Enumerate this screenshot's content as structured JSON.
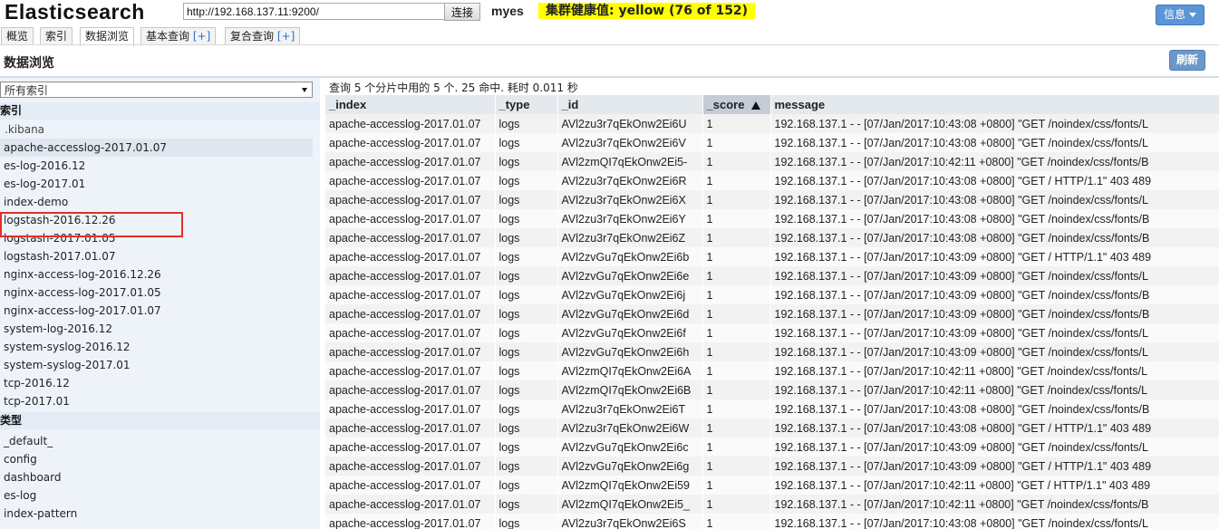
{
  "header": {
    "app_title": "Elasticsearch",
    "cluster_url": "http://192.168.137.11:9200/",
    "connect_label": "连接",
    "cluster_name": "myes",
    "health_text": "集群健康值: yellow (76 of 152)",
    "health_color": "#ffff00",
    "info_label": "信息"
  },
  "tabs": [
    {
      "label": "概览",
      "plus": ""
    },
    {
      "label": "索引",
      "plus": ""
    },
    {
      "label": "数据浏览",
      "plus": ""
    },
    {
      "label": "基本查询 ",
      "plus": "[+]"
    },
    {
      "label": "复合查询 ",
      "plus": "[+]"
    }
  ],
  "page": {
    "title": "数据浏览",
    "refresh_label": "刷新"
  },
  "sidebar": {
    "select_value": "所有索引",
    "indices_heading": "索引",
    "indices": [
      ".kibana",
      "apache-accesslog-2017.01.07",
      "es-log-2016.12",
      "es-log-2017.01",
      "index-demo",
      "logstash-2016.12.26",
      "logstash-2017.01.05",
      "logstash-2017.01.07",
      "nginx-access-log-2016.12.26",
      "nginx-access-log-2017.01.05",
      "nginx-access-log-2017.01.07",
      "system-log-2016.12",
      "system-syslog-2016.12",
      "system-syslog-2017.01",
      "tcp-2016.12",
      "tcp-2017.01"
    ],
    "types_heading": "类型",
    "types": [
      "_default_",
      "config",
      "dashboard",
      "es-log",
      "index-pattern"
    ]
  },
  "results": {
    "summary": "查询 5 个分片中用的 5 个. 25 命中. 耗时 0.011 秒",
    "columns": [
      "_index",
      "_type",
      "_id",
      "_score",
      "message"
    ],
    "rows": [
      [
        "apache-accesslog-2017.01.07",
        "logs",
        "AVl2zu3r7qEkOnw2Ei6U",
        "1",
        "192.168.137.1 - - [07/Jan/2017:10:43:08 +0800] \"GET /noindex/css/fonts/L"
      ],
      [
        "apache-accesslog-2017.01.07",
        "logs",
        "AVl2zu3r7qEkOnw2Ei6V",
        "1",
        "192.168.137.1 - - [07/Jan/2017:10:43:08 +0800] \"GET /noindex/css/fonts/L"
      ],
      [
        "apache-accesslog-2017.01.07",
        "logs",
        "AVl2zmQI7qEkOnw2Ei5-",
        "1",
        "192.168.137.1 - - [07/Jan/2017:10:42:11 +0800] \"GET /noindex/css/fonts/B"
      ],
      [
        "apache-accesslog-2017.01.07",
        "logs",
        "AVl2zu3r7qEkOnw2Ei6R",
        "1",
        "192.168.137.1 - - [07/Jan/2017:10:43:08 +0800] \"GET / HTTP/1.1\" 403 489"
      ],
      [
        "apache-accesslog-2017.01.07",
        "logs",
        "AVl2zu3r7qEkOnw2Ei6X",
        "1",
        "192.168.137.1 - - [07/Jan/2017:10:43:08 +0800] \"GET /noindex/css/fonts/L"
      ],
      [
        "apache-accesslog-2017.01.07",
        "logs",
        "AVl2zu3r7qEkOnw2Ei6Y",
        "1",
        "192.168.137.1 - - [07/Jan/2017:10:43:08 +0800] \"GET /noindex/css/fonts/B"
      ],
      [
        "apache-accesslog-2017.01.07",
        "logs",
        "AVl2zu3r7qEkOnw2Ei6Z",
        "1",
        "192.168.137.1 - - [07/Jan/2017:10:43:08 +0800] \"GET /noindex/css/fonts/B"
      ],
      [
        "apache-accesslog-2017.01.07",
        "logs",
        "AVl2zvGu7qEkOnw2Ei6b",
        "1",
        "192.168.137.1 - - [07/Jan/2017:10:43:09 +0800] \"GET / HTTP/1.1\" 403 489"
      ],
      [
        "apache-accesslog-2017.01.07",
        "logs",
        "AVl2zvGu7qEkOnw2Ei6e",
        "1",
        "192.168.137.1 - - [07/Jan/2017:10:43:09 +0800] \"GET /noindex/css/fonts/L"
      ],
      [
        "apache-accesslog-2017.01.07",
        "logs",
        "AVl2zvGu7qEkOnw2Ei6j",
        "1",
        "192.168.137.1 - - [07/Jan/2017:10:43:09 +0800] \"GET /noindex/css/fonts/B"
      ],
      [
        "apache-accesslog-2017.01.07",
        "logs",
        "AVl2zvGu7qEkOnw2Ei6d",
        "1",
        "192.168.137.1 - - [07/Jan/2017:10:43:09 +0800] \"GET /noindex/css/fonts/B"
      ],
      [
        "apache-accesslog-2017.01.07",
        "logs",
        "AVl2zvGu7qEkOnw2Ei6f",
        "1",
        "192.168.137.1 - - [07/Jan/2017:10:43:09 +0800] \"GET /noindex/css/fonts/L"
      ],
      [
        "apache-accesslog-2017.01.07",
        "logs",
        "AVl2zvGu7qEkOnw2Ei6h",
        "1",
        "192.168.137.1 - - [07/Jan/2017:10:43:09 +0800] \"GET /noindex/css/fonts/L"
      ],
      [
        "apache-accesslog-2017.01.07",
        "logs",
        "AVl2zmQI7qEkOnw2Ei6A",
        "1",
        "192.168.137.1 - - [07/Jan/2017:10:42:11 +0800] \"GET /noindex/css/fonts/L"
      ],
      [
        "apache-accesslog-2017.01.07",
        "logs",
        "AVl2zmQI7qEkOnw2Ei6B",
        "1",
        "192.168.137.1 - - [07/Jan/2017:10:42:11 +0800] \"GET /noindex/css/fonts/L"
      ],
      [
        "apache-accesslog-2017.01.07",
        "logs",
        "AVl2zu3r7qEkOnw2Ei6T",
        "1",
        "192.168.137.1 - - [07/Jan/2017:10:43:08 +0800] \"GET /noindex/css/fonts/B"
      ],
      [
        "apache-accesslog-2017.01.07",
        "logs",
        "AVl2zu3r7qEkOnw2Ei6W",
        "1",
        "192.168.137.1 - - [07/Jan/2017:10:43:08 +0800] \"GET / HTTP/1.1\" 403 489"
      ],
      [
        "apache-accesslog-2017.01.07",
        "logs",
        "AVl2zvGu7qEkOnw2Ei6c",
        "1",
        "192.168.137.1 - - [07/Jan/2017:10:43:09 +0800] \"GET /noindex/css/fonts/L"
      ],
      [
        "apache-accesslog-2017.01.07",
        "logs",
        "AVl2zvGu7qEkOnw2Ei6g",
        "1",
        "192.168.137.1 - - [07/Jan/2017:10:43:09 +0800] \"GET / HTTP/1.1\" 403 489"
      ],
      [
        "apache-accesslog-2017.01.07",
        "logs",
        "AVl2zmQI7qEkOnw2Ei59",
        "1",
        "192.168.137.1 - - [07/Jan/2017:10:42:11 +0800] \"GET / HTTP/1.1\" 403 489"
      ],
      [
        "apache-accesslog-2017.01.07",
        "logs",
        "AVl2zmQI7qEkOnw2Ei5_",
        "1",
        "192.168.137.1 - - [07/Jan/2017:10:42:11 +0800] \"GET /noindex/css/fonts/B"
      ],
      [
        "apache-accesslog-2017.01.07",
        "logs",
        "AVl2zu3r7qEkOnw2Ei6S",
        "1",
        "192.168.137.1 - - [07/Jan/2017:10:43:08 +0800] \"GET /noindex/css/fonts/L"
      ]
    ]
  }
}
